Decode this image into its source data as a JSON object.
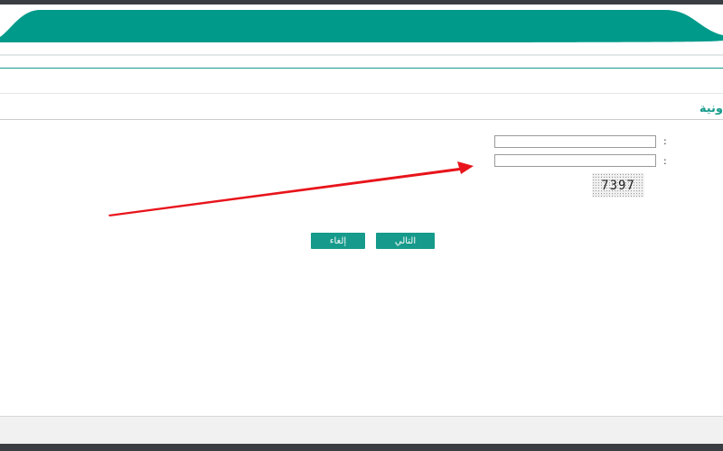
{
  "header": {
    "banner_color": "#009a8a",
    "breadcrumb": "",
    "section_title": "ونية"
  },
  "form": {
    "field1": {
      "label": ":",
      "value": ""
    },
    "field2": {
      "label": ":",
      "value": ""
    },
    "captcha": {
      "code": "7397"
    }
  },
  "annotation": {
    "color": "#e8141b",
    "icon": "red-arrow-icon"
  },
  "actions": {
    "next_label": "التالي",
    "cancel_label": "إلغاء"
  },
  "colors": {
    "accent": "#169a8b",
    "arrow": "#e8141b"
  }
}
